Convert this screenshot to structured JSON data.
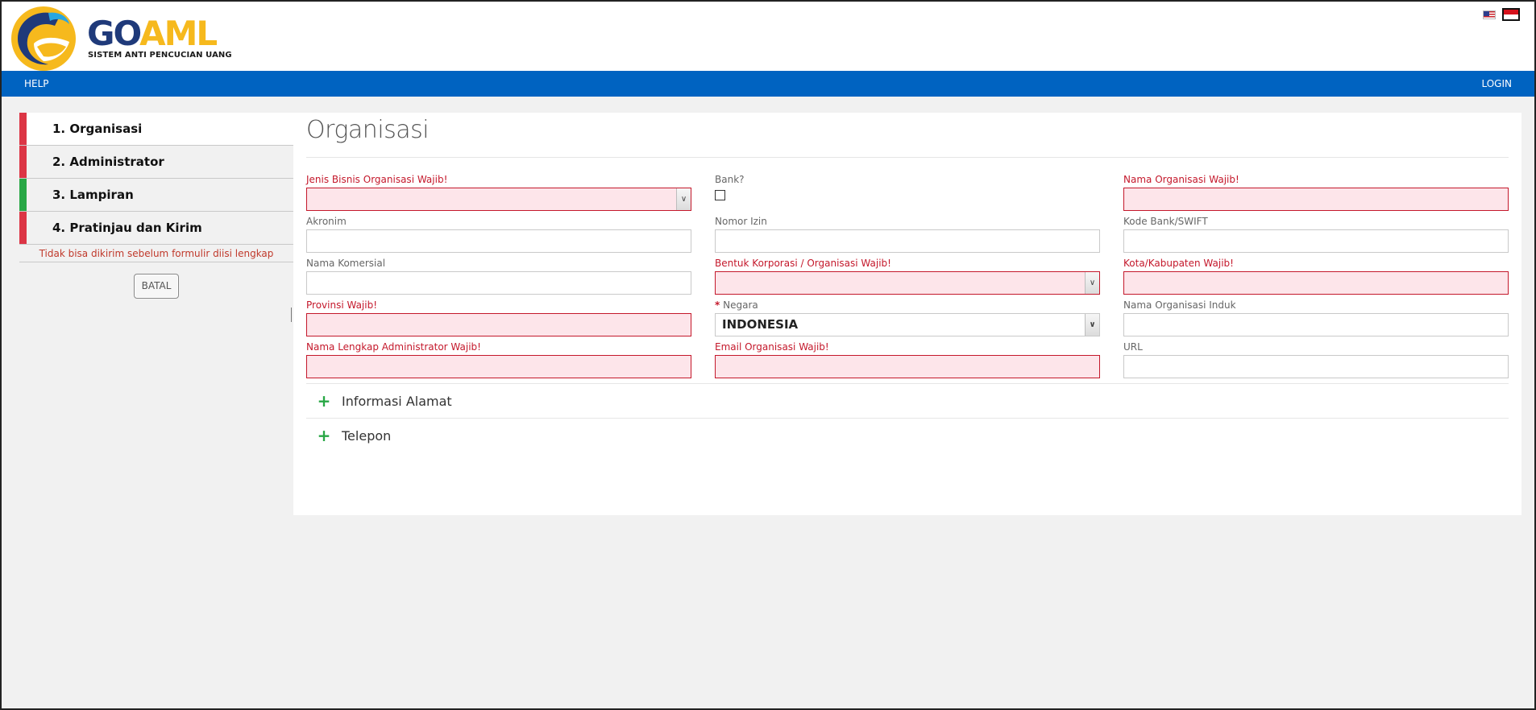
{
  "header": {
    "logo_go": "GO",
    "logo_aml": "AML",
    "logo_subtitle": "SISTEM ANTI PENCUCIAN UANG",
    "lang_flags": [
      {
        "name": "english-flag-icon"
      },
      {
        "name": "indonesian-flag-icon"
      }
    ]
  },
  "navbar": {
    "help": "HELP",
    "login": "LOGIN"
  },
  "sidebar": {
    "steps": [
      {
        "label": "1. Organisasi",
        "status": "incomplete"
      },
      {
        "label": "2. Administrator",
        "status": "incomplete"
      },
      {
        "label": "3. Lampiran",
        "status": "complete"
      },
      {
        "label": "4. Pratinjau dan Kirim",
        "status": "incomplete"
      }
    ],
    "warning": "Tidak bisa dikirim sebelum formulir diisi lengkap",
    "cancel_label": "BATAL"
  },
  "form": {
    "title": "Organisasi",
    "fields": {
      "jenis_bisnis": {
        "label": "Jenis Bisnis Organisasi Wajib!",
        "value": ""
      },
      "bank": {
        "label": "Bank?",
        "checked": false
      },
      "nama_organisasi": {
        "label": "Nama Organisasi Wajib!",
        "value": ""
      },
      "akronim": {
        "label": "Akronim",
        "value": ""
      },
      "nomor_izin": {
        "label": "Nomor Izin",
        "value": ""
      },
      "kode_bank": {
        "label": "Kode Bank/SWIFT",
        "value": ""
      },
      "nama_komersial": {
        "label": "Nama Komersial",
        "value": ""
      },
      "bentuk_korporasi": {
        "label": "Bentuk Korporasi / Organisasi Wajib!",
        "value": ""
      },
      "kota": {
        "label": "Kota/Kabupaten Wajib!",
        "value": ""
      },
      "provinsi": {
        "label": "Provinsi Wajib!",
        "value": ""
      },
      "negara": {
        "star": "*",
        "label": "Negara",
        "value": "INDONESIA"
      },
      "nama_induk": {
        "label": "Nama Organisasi Induk",
        "value": ""
      },
      "nama_admin": {
        "label": "Nama Lengkap Administrator Wajib!",
        "value": ""
      },
      "email": {
        "label": "Email Organisasi Wajib!",
        "value": ""
      },
      "url": {
        "label": "URL",
        "value": ""
      }
    },
    "sections": [
      {
        "label": "Informasi Alamat"
      },
      {
        "label": "Telepon"
      }
    ]
  },
  "colors": {
    "navbar": "#0063c1",
    "error_text": "#c4182b",
    "error_bg": "#fde5ea",
    "step_incomplete": "#dc3545",
    "step_complete": "#28a745",
    "logo_blue": "#1f3a7a",
    "logo_yellow": "#f6b91d"
  }
}
